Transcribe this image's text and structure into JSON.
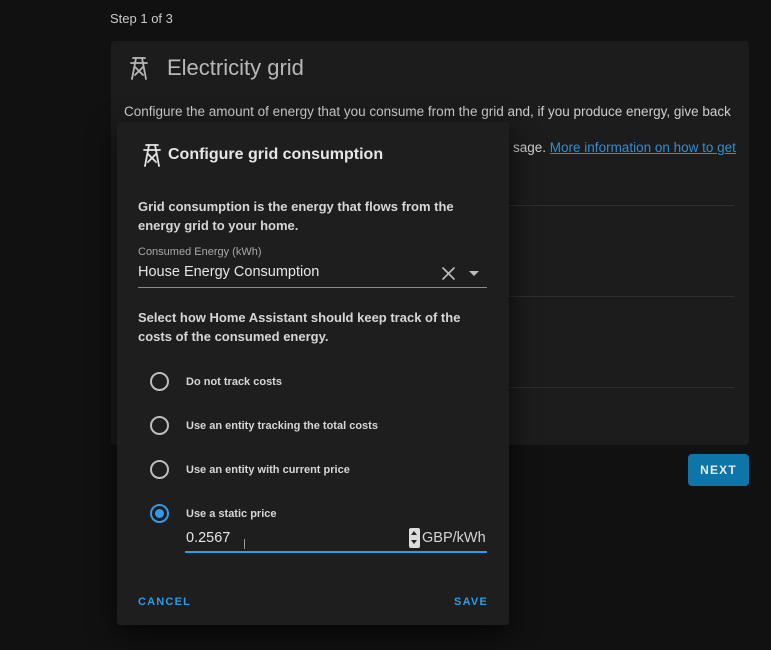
{
  "page": {
    "step_label": "Step 1 of 3"
  },
  "background_card": {
    "icon": "transmission-tower-icon",
    "title": "Electricity grid",
    "description_line1": "Configure the amount of energy that you consume from the grid and, if you produce energy, give back to the",
    "description_line2_visible": "sage.",
    "more_info_link": "More information on how to get"
  },
  "next_button": {
    "label": "NEXT",
    "color": "#0e75a8"
  },
  "dialog": {
    "icon": "transmission-tower-icon",
    "title": "Configure grid consumption",
    "intro": "Grid consumption is the energy that flows from the energy grid to your home.",
    "consumed_energy": {
      "label": "Consumed Energy (kWh)",
      "value": "House Energy Consumption",
      "clear_icon": "close-icon",
      "dropdown_icon": "chevron-down-icon"
    },
    "cost_intro": "Select how Home Assistant should keep track of the costs of the consumed energy.",
    "cost_options": [
      {
        "label": "Do not track costs",
        "checked": false
      },
      {
        "label": "Use an entity tracking the total costs",
        "checked": false
      },
      {
        "label": "Use an entity with current price",
        "checked": false
      },
      {
        "label": "Use a static price",
        "checked": true
      }
    ],
    "static_price": {
      "value": "0.2567",
      "unit": "GBP/kWh"
    },
    "cancel_label": "CANCEL",
    "save_label": "SAVE",
    "accent_color": "#2d9be6"
  }
}
